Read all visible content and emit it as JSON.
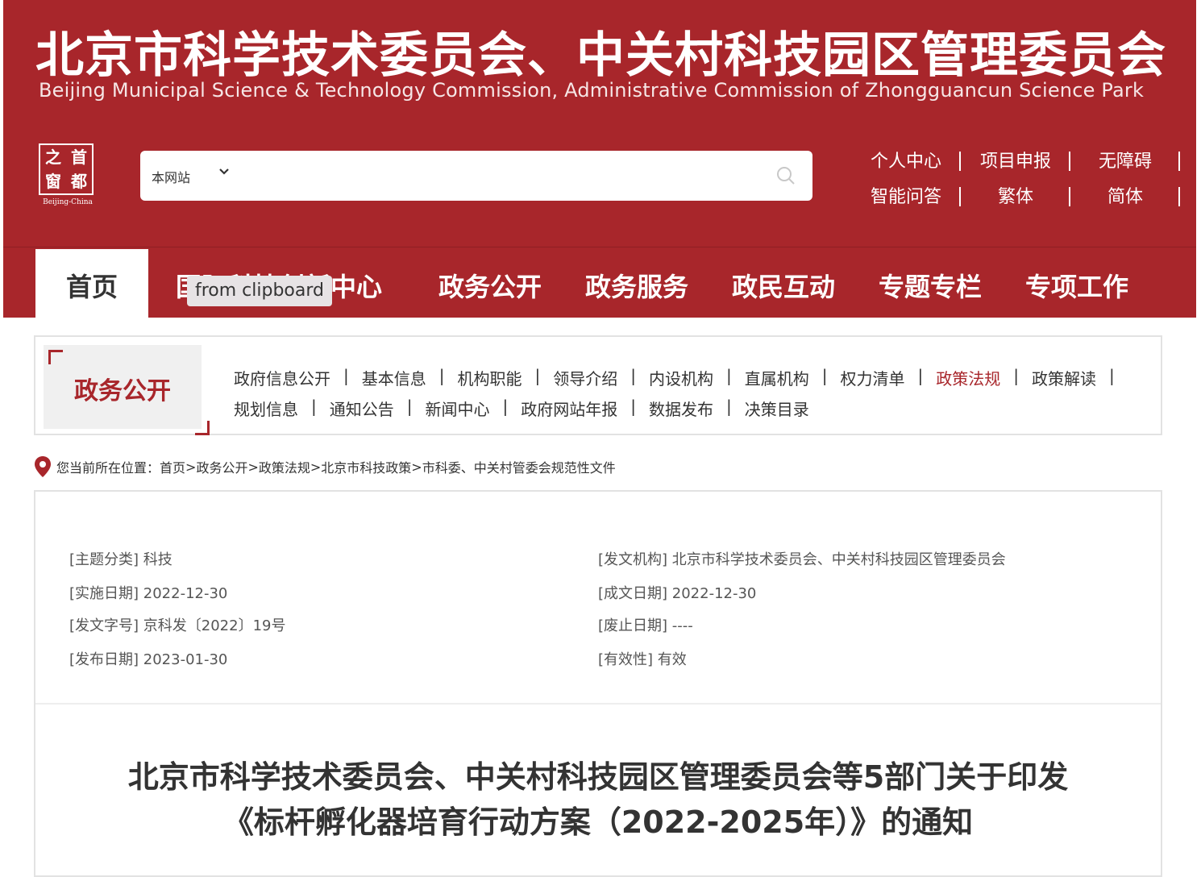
{
  "header": {
    "title_cn": "北京市科学技术委员会、中关村科技园区管理委员会",
    "title_en": "Beijing Municipal Science & Technology Commission, Administrative Commission of Zhongguancun Science Park",
    "logo": {
      "chars": [
        "之",
        "首",
        "窗",
        "都"
      ],
      "caption": "Beijing-China"
    },
    "search": {
      "scope": "本网站",
      "placeholder": ""
    },
    "links_row1": [
      "个人中心",
      "项目申报",
      "无障碍"
    ],
    "links_row2": [
      "智能问答",
      "繁体",
      "简体"
    ]
  },
  "nav": {
    "home": "首页",
    "items": [
      "国际科技创新中心",
      "政务公开",
      "政务服务",
      "政民互动",
      "专题专栏",
      "专项工作"
    ]
  },
  "tooltip": "from clipboard",
  "submenu": {
    "label": "政务公开",
    "row1": [
      "政府信息公开",
      "基本信息",
      "机构职能",
      "领导介绍",
      "内设机构",
      "直属机构",
      "权力清单",
      "政策法规",
      "政策解读"
    ],
    "row2": [
      "规划信息",
      "通知公告",
      "新闻中心",
      "政府网站年报",
      "数据发布",
      "决策目录"
    ],
    "active": "政策法规"
  },
  "breadcrumb": {
    "prefix": "您当前所在位置：",
    "items": [
      "首页",
      "政务公开",
      "政策法规",
      "北京市科技政策",
      "市科委、中关村管委会规范性文件"
    ],
    "sep": ">"
  },
  "meta": {
    "left": [
      "[主题分类] 科技",
      "[实施日期] 2022-12-30",
      "[发文字号] 京科发〔2022〕19号",
      "[发布日期] 2023-01-30"
    ],
    "right": [
      "[发文机构] 北京市科学技术委员会、中关村科技园区管理委员会",
      "[成文日期] 2022-12-30",
      "[废止日期] ----",
      "[有效性] 有效"
    ]
  },
  "document": {
    "title_line1": "北京市科学技术委员会、中关村科技园区管理委员会等5部门关于印发",
    "title_line2": "《标杆孵化器培育行动方案（2022-2025年）》的通知"
  },
  "colors": {
    "brand": "#a8262b",
    "border": "#e2e2e2"
  }
}
